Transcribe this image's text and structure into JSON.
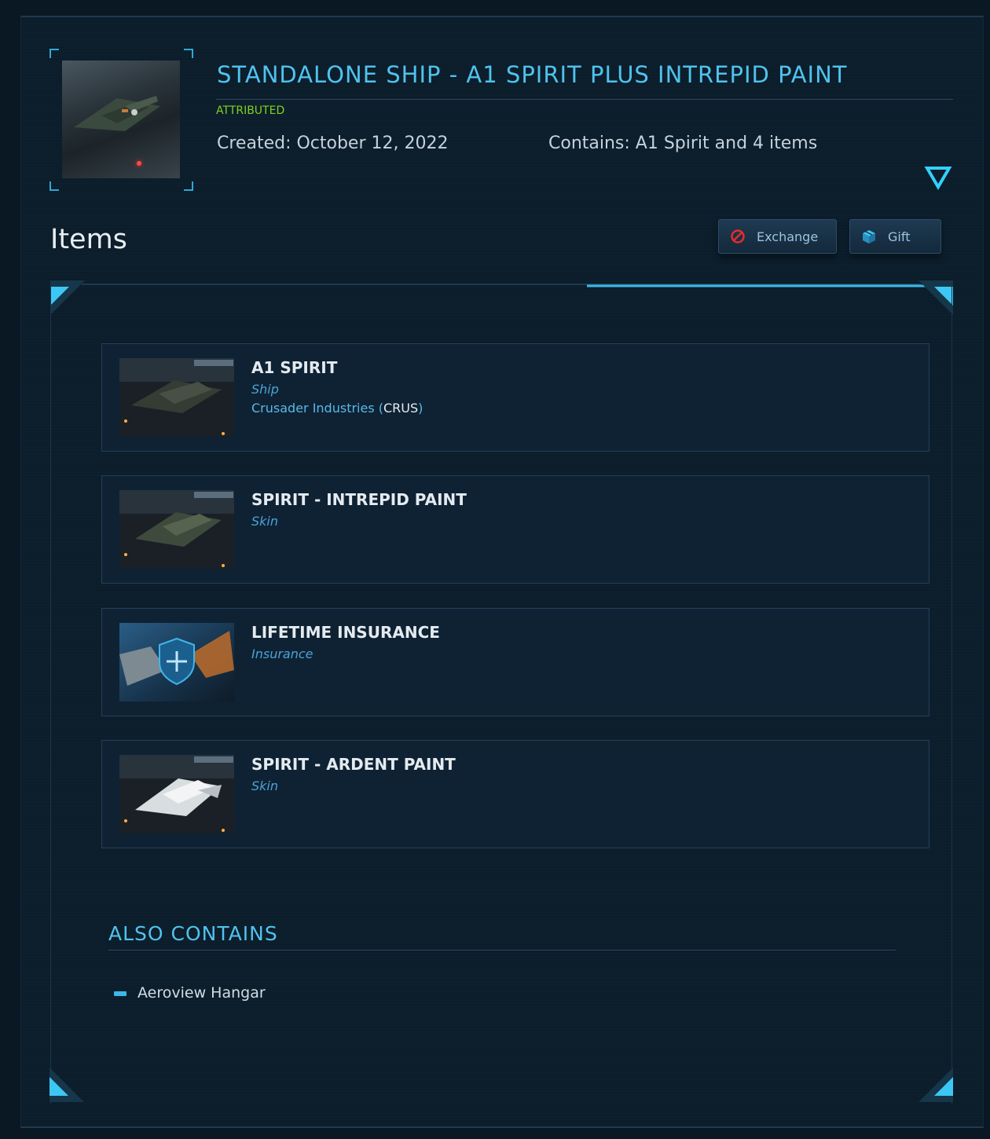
{
  "pledge": {
    "title": "STANDALONE SHIP - A1 SPIRIT PLUS INTREPID PAINT",
    "status": "ATTRIBUTED",
    "created": "Created: October 12, 2022",
    "contains": "Contains: A1 Spirit and 4 items"
  },
  "items_section": {
    "title": "Items",
    "exchange_label": "Exchange",
    "gift_label": "Gift"
  },
  "items": [
    {
      "name": "A1 SPIRIT",
      "type": "Ship",
      "manufacturer": "Crusader Industries (",
      "manufacturer_code": "CRUS",
      "manufacturer_close": ")"
    },
    {
      "name": "SPIRIT - INTREPID PAINT",
      "type": "Skin"
    },
    {
      "name": "LIFETIME INSURANCE",
      "type": "Insurance"
    },
    {
      "name": "SPIRIT - ARDENT PAINT",
      "type": "Skin"
    }
  ],
  "also_contains": {
    "title": "ALSO CONTAINS",
    "items": [
      "Aeroview Hangar"
    ]
  },
  "colors": {
    "accent": "#4fc3ee",
    "status_green": "#7ed321",
    "card_bg": "#0f2233"
  },
  "icons": {
    "exchange": "prohibited-icon",
    "gift": "gift-cube-icon",
    "expand": "triangle-down-icon"
  }
}
